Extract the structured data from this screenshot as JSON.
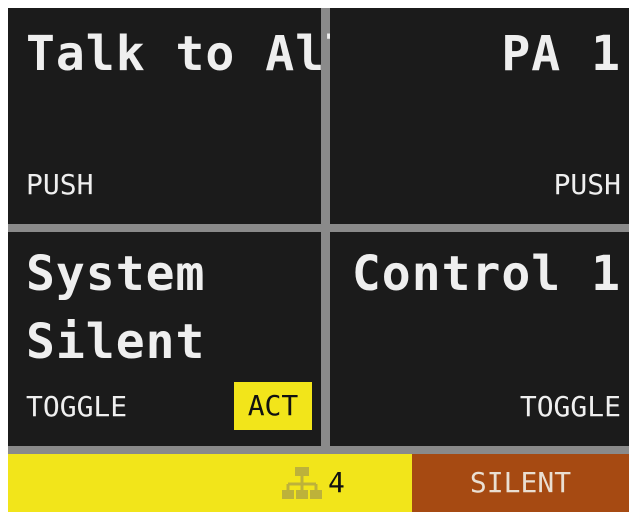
{
  "panels": {
    "top_left": {
      "title": "Talk to All",
      "mode": "PUSH"
    },
    "top_right": {
      "title": "PA 1",
      "mode": "PUSH"
    },
    "bottom_left": {
      "title_line1": "System",
      "title_line2": "Silent",
      "mode": "TOGGLE",
      "badge": "ACT"
    },
    "bottom_right": {
      "title": "Control 1",
      "mode": "TOGGLE"
    }
  },
  "status_bar": {
    "network_icon": "network-topology-icon",
    "count": "4",
    "state": "SILENT"
  },
  "colors": {
    "panel_bg": "#1b1b1b",
    "divider": "#8a8a8a",
    "accent_yellow": "#f2e51a",
    "silent_orange": "#a64a12"
  }
}
